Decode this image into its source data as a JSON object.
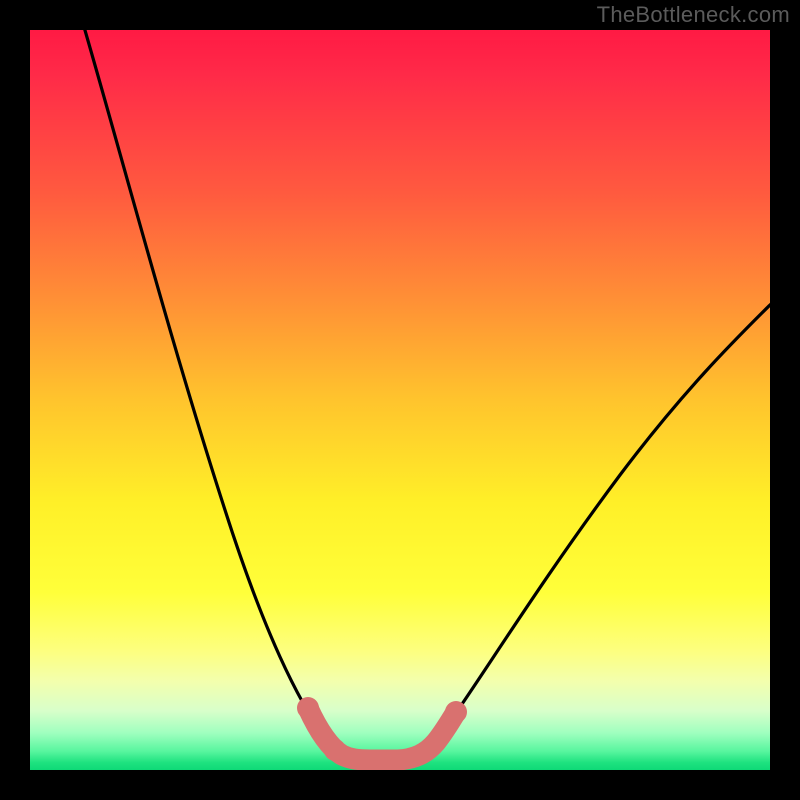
{
  "watermark": "TheBottleneck.com",
  "chart_data": {
    "type": "line",
    "title": "",
    "xlabel": "",
    "ylabel": "",
    "ylim": [
      0,
      100
    ],
    "xlim": [
      0,
      100
    ],
    "series": [
      {
        "name": "bottleneck-curve",
        "points": [
          {
            "x": 10,
            "y": 100
          },
          {
            "x": 14,
            "y": 80
          },
          {
            "x": 19,
            "y": 60
          },
          {
            "x": 25,
            "y": 40
          },
          {
            "x": 31,
            "y": 22
          },
          {
            "x": 36,
            "y": 10
          },
          {
            "x": 40,
            "y": 3
          },
          {
            "x": 44,
            "y": 1
          },
          {
            "x": 50,
            "y": 1
          },
          {
            "x": 54,
            "y": 3
          },
          {
            "x": 60,
            "y": 10
          },
          {
            "x": 68,
            "y": 22
          },
          {
            "x": 78,
            "y": 36
          },
          {
            "x": 90,
            "y": 50
          },
          {
            "x": 100,
            "y": 59
          }
        ]
      },
      {
        "name": "optimal-region-marker",
        "color": "#d9716f",
        "points": [
          {
            "x": 39,
            "y": 7
          },
          {
            "x": 40,
            "y": 3
          },
          {
            "x": 44,
            "y": 1
          },
          {
            "x": 50,
            "y": 1
          },
          {
            "x": 54,
            "y": 3
          },
          {
            "x": 56,
            "y": 6
          }
        ]
      }
    ],
    "background_gradient": [
      "#ff1a44",
      "#ff5a3f",
      "#ff8e36",
      "#ffc42d",
      "#fff028",
      "#fdff80",
      "#d8ffca",
      "#1ee27f"
    ]
  }
}
